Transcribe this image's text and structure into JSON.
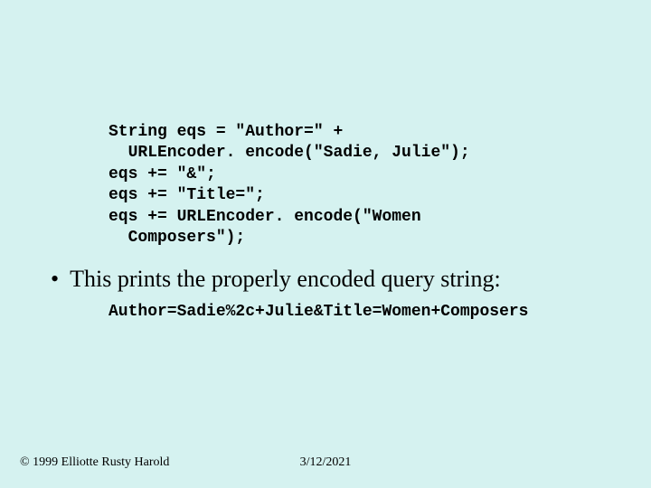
{
  "code": "String eqs = \"Author=\" +\n  URLEncoder. encode(\"Sadie, Julie\");\neqs += \"&\";\neqs += \"Title=\";\neqs += URLEncoder. encode(\"Women\n  Composers\");",
  "bullet_text": "This prints the properly encoded query string:",
  "output": "Author=Sadie%2c+Julie&Title=Women+Composers",
  "footer": {
    "copyright": "© 1999 Elliotte Rusty Harold",
    "date": "3/12/2021"
  }
}
